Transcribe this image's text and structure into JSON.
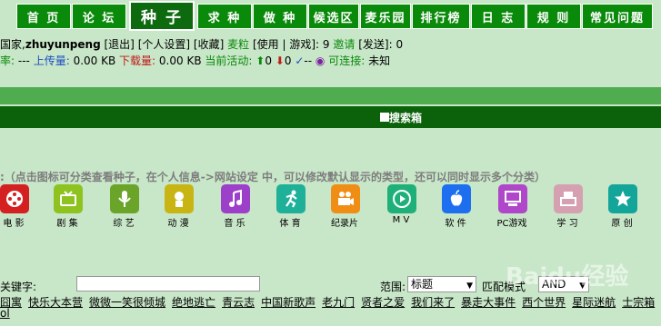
{
  "nav": [
    {
      "label": "首 页"
    },
    {
      "label": "论 坛"
    },
    {
      "label": "种 子"
    },
    {
      "label": "求 种"
    },
    {
      "label": "做 种"
    },
    {
      "label": "候选区"
    },
    {
      "label": "麦乐园"
    },
    {
      "label": "排行榜"
    },
    {
      "label": "日 志"
    },
    {
      "label": "规 则"
    },
    {
      "label": "常见问题"
    }
  ],
  "userbar": {
    "prefix": "国家,",
    "username": "zhuyunpeng",
    "logout": "[退出]",
    "settings": "[个人设置]",
    "favorites": "[收藏]",
    "wheat": "麦粒",
    "use": "[使用",
    "games_sep": "| 游戏]:",
    "games_count": "9",
    "invite": "邀请",
    "sent": "[发送]:",
    "sent_count": "0"
  },
  "stats": {
    "ratio_label": "率:",
    "ratio_value": "---",
    "upload_label": "上传量:",
    "upload_value": "0.00 KB",
    "download_label": "下载量:",
    "download_value": "0.00 KB",
    "activity_label": "当前活动:",
    "seeding_count": "0",
    "leeching_count": "0",
    "completed_value": "--",
    "connectable_label": "可连接:",
    "connectable_value": "未知"
  },
  "search_box_title": "搜索箱",
  "hint": ":（点击图标可分类查看种子，在个人信息->网站设定 中，可以修改默认显示的类型，还可以同时显示多个分类）",
  "categories": [
    {
      "label": "电 影",
      "color": "#d42020",
      "icon": "film-icon"
    },
    {
      "label": "剧 集",
      "color": "#8dc21f",
      "icon": "tv-icon"
    },
    {
      "label": "综 艺",
      "color": "#6aa52a",
      "icon": "microphone-icon"
    },
    {
      "label": "动 漫",
      "color": "#c8b413",
      "icon": "anime-icon"
    },
    {
      "label": "音 乐",
      "color": "#9c3fc9",
      "icon": "music-note-icon"
    },
    {
      "label": "体 育",
      "color": "#1fb09a",
      "icon": "runner-icon"
    },
    {
      "label": "纪录片",
      "color": "#f08d14",
      "icon": "camera-icon"
    },
    {
      "label": "M V",
      "color": "#1fb07a",
      "icon": "mv-play-icon"
    },
    {
      "label": "软 件",
      "color": "#1d6ff0",
      "icon": "apple-icon"
    },
    {
      "label": "PC游戏",
      "color": "#b046c9",
      "icon": "computer-icon"
    },
    {
      "label": "学 习",
      "color": "#d5a0b0",
      "icon": "printer-icon"
    },
    {
      "label": "原 创",
      "color": "#13a59a",
      "icon": "star-icon"
    }
  ],
  "search": {
    "keyword_label": "关键字:",
    "keyword_value": "",
    "range_label": "范围:",
    "range_value": "标题",
    "match_label": "匹配模式",
    "match_value": "AND"
  },
  "tags": [
    "囧寓",
    "快乐大本营",
    "微微一笑很倾城",
    "绝地逃亡",
    "青云志",
    "中国新歌声",
    "老九门",
    "贤者之爱",
    "我们来了",
    "暴走大事件",
    "西个世界",
    "星际迷航",
    "士宗箱"
  ],
  "tail": "ol",
  "watermark": "Baidu经验"
}
